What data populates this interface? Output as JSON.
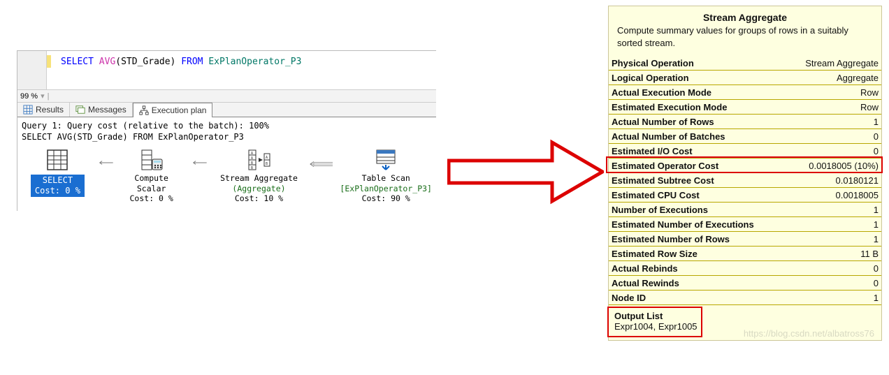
{
  "editor": {
    "kw_select": "SELECT",
    "kw_avg": "AVG",
    "col_open": "(STD_Grade)",
    "kw_from": "FROM",
    "table": "ExPlanOperator_P3"
  },
  "zoom": {
    "value": "99 %"
  },
  "tabs": {
    "results": "Results",
    "messages": "Messages",
    "plan": "Execution plan"
  },
  "plan_info": {
    "line1": "Query 1: Query cost (relative to the batch): 100%",
    "line2": "SELECT AVG(STD_Grade) FROM ExPlanOperator_P3"
  },
  "ops": {
    "select": {
      "label": "SELECT",
      "cost": "Cost: 0 %"
    },
    "compute": {
      "label": "Compute Scalar",
      "cost": "Cost: 0 %"
    },
    "stream": {
      "label1": "Stream Aggregate",
      "label2": "(Aggregate)",
      "cost": "Cost: 10 %"
    },
    "scan": {
      "label1": "Table Scan",
      "label2": "[ExPlanOperator_P3]",
      "cost": "Cost: 90 %"
    }
  },
  "tooltip": {
    "title": "Stream Aggregate",
    "desc": "Compute summary values for groups of rows in a suitably sorted stream.",
    "rows": [
      {
        "k": "Physical Operation",
        "v": "Stream Aggregate"
      },
      {
        "k": "Logical Operation",
        "v": "Aggregate"
      },
      {
        "k": "Actual Execution Mode",
        "v": "Row"
      },
      {
        "k": "Estimated Execution Mode",
        "v": "Row"
      },
      {
        "k": "Actual Number of Rows",
        "v": "1"
      },
      {
        "k": "Actual Number of Batches",
        "v": "0"
      },
      {
        "k": "Estimated I/O Cost",
        "v": "0"
      },
      {
        "k": "Estimated Operator Cost",
        "v": "0.0018005 (10%)"
      },
      {
        "k": "Estimated Subtree Cost",
        "v": "0.0180121"
      },
      {
        "k": "Estimated CPU Cost",
        "v": "0.0018005"
      },
      {
        "k": "Number of Executions",
        "v": "1"
      },
      {
        "k": "Estimated Number of Executions",
        "v": "1"
      },
      {
        "k": "Estimated Number of Rows",
        "v": "1"
      },
      {
        "k": "Estimated Row Size",
        "v": "11 B"
      },
      {
        "k": "Actual Rebinds",
        "v": "0"
      },
      {
        "k": "Actual Rewinds",
        "v": "0"
      },
      {
        "k": "Node ID",
        "v": "1"
      }
    ],
    "highlight_index": 7,
    "output_title": "Output List",
    "output_value": "Expr1004, Expr1005"
  },
  "watermark": "https://blog.csdn.net/albatross76"
}
